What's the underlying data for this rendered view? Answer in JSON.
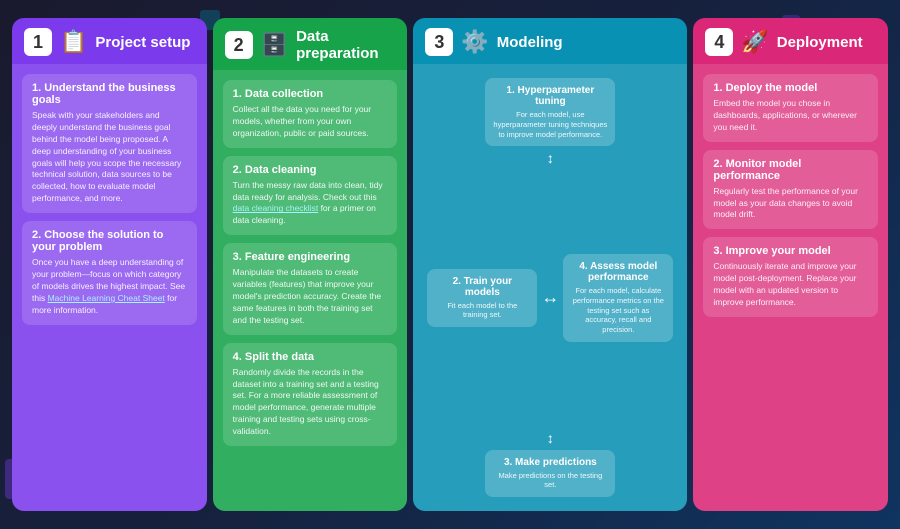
{
  "columns": [
    {
      "id": "project-setup",
      "number": "1",
      "icon": "📋",
      "title": "Project setup",
      "color": "col-1",
      "cards": [
        {
          "title": "1. Understand the business goals",
          "text": "Speak with your stakeholders and deeply understand the business goal behind the model being proposed. A deep understanding of your business goals will help you scope the necessary technical solution, data sources to be collected, how to evaluate model performance, and more."
        },
        {
          "title": "2. Choose the solution to your problem",
          "text": "Once you have a deep understanding of your problem—focus on which category of models drives the highest impact. See this Machine Learning Cheat Sheet for more information.",
          "link": "Machine Learning Cheat Sheet"
        }
      ]
    },
    {
      "id": "data-preparation",
      "number": "2",
      "icon": "🗄️",
      "title": "Data preparation",
      "color": "col-2",
      "cards": [
        {
          "title": "1. Data collection",
          "text": "Collect all the data you need for your models, whether from your own organization, public or paid sources."
        },
        {
          "title": "2. Data cleaning",
          "text": "Turn the messy raw data into clean, tidy data ready for analysis. Check out this data cleaning checklist for a primer on data cleaning.",
          "link": "data cleaning checklist"
        },
        {
          "title": "3. Feature engineering",
          "text": "Manipulate the datasets to create variables (features) that improve your model's prediction accuracy. Create the same features in both the training set and the testing set."
        },
        {
          "title": "4. Split the data",
          "text": "Randomly divide the records in the dataset into a training set and a testing set. For a more reliable assessment of model performance, generate multiple training and testing sets using cross-validation."
        }
      ]
    },
    {
      "id": "modeling",
      "number": "3",
      "icon": "⚙️",
      "title": "Modeling",
      "color": "col-3",
      "diagram": {
        "top": {
          "title": "1. Hyperparameter tuning",
          "text": "For each model, use hyperparameter tuning techniques to improve model performance."
        },
        "left": {
          "title": "2. Train your models",
          "text": "Fit each model to the training set."
        },
        "right": {
          "title": "4. Assess model performance",
          "text": "For each model, calculate performance metrics on the testing set such as accuracy, recall and precision."
        },
        "bottom": {
          "title": "3. Make predictions",
          "text": "Make predictions on the testing set."
        }
      }
    },
    {
      "id": "deployment",
      "number": "4",
      "icon": "🚀",
      "title": "Deployment",
      "color": "col-4",
      "cards": [
        {
          "title": "1. Deploy the model",
          "text": "Embed the model you chose in dashboards, applications, or wherever you need it."
        },
        {
          "title": "2. Monitor model performance",
          "text": "Regularly test the performance of your model as your data changes to avoid model drift."
        },
        {
          "title": "3. Improve your model",
          "text": "Continuously iterate and improve your model post-deployment. Replace your model with an updated version to improve performance."
        }
      ]
    }
  ]
}
